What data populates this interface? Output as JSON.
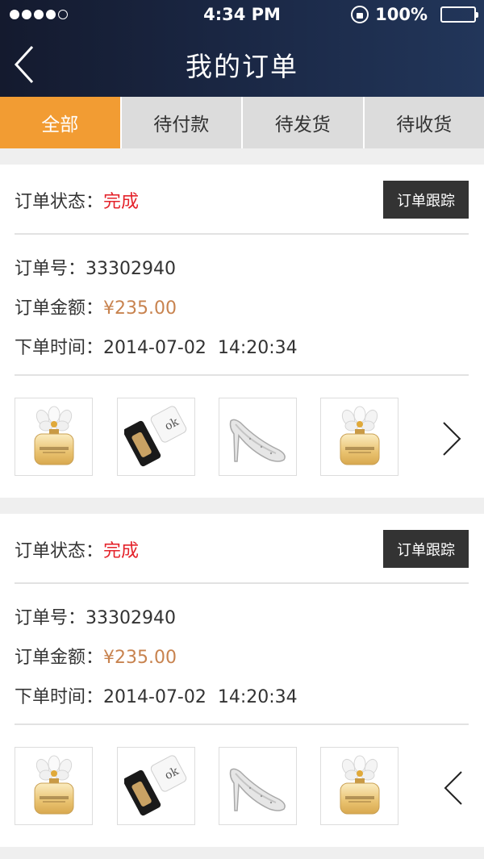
{
  "status_bar": {
    "time": "4:34 PM",
    "battery": "100%"
  },
  "header": {
    "title": "我的订单"
  },
  "tabs": [
    {
      "label": "全部",
      "active": true
    },
    {
      "label": "待付款"
    },
    {
      "label": "待发货"
    },
    {
      "label": "待收货"
    }
  ],
  "orders": [
    {
      "status_label": "订单状态：",
      "status_value": "完成",
      "track_label": "订单跟踪",
      "number_label": "订单号：",
      "number": "33302940",
      "amount_label": "订单金额：",
      "amount": "¥235.00",
      "time_label": "下单时间：",
      "time": "2014-07-02  14:20:34",
      "products": [
        "perfume-bottle-icon",
        "skincare-bottle-icon",
        "high-heel-shoe-icon",
        "perfume-bottle-icon"
      ],
      "nav_arrow": "chevron-right-icon"
    },
    {
      "status_label": "订单状态：",
      "status_value": "完成",
      "track_label": "订单跟踪",
      "number_label": "订单号：",
      "number": "33302940",
      "amount_label": "订单金额：",
      "amount": "¥235.00",
      "time_label": "下单时间：",
      "time": "2014-07-02  14:20:34",
      "products": [
        "perfume-bottle-icon",
        "skincare-bottle-icon",
        "high-heel-shoe-icon",
        "perfume-bottle-icon"
      ],
      "nav_arrow": "chevron-left-icon"
    }
  ],
  "colors": {
    "header_bg": "#1b2947",
    "tab_active": "#f29c33",
    "status_complete": "#e4222a",
    "amount": "#c8834f",
    "track_button_bg": "#333333"
  }
}
